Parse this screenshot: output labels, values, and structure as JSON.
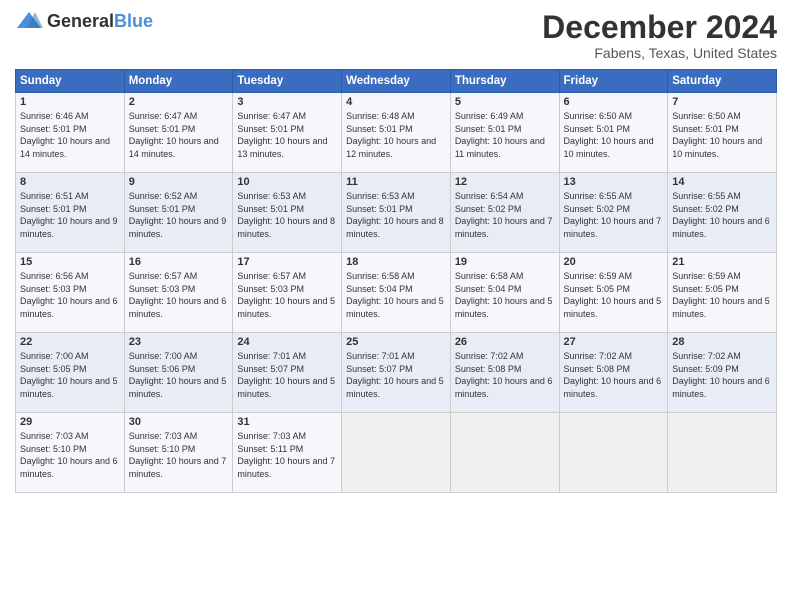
{
  "header": {
    "logo_general": "General",
    "logo_blue": "Blue",
    "month_title": "December 2024",
    "location": "Fabens, Texas, United States"
  },
  "weekdays": [
    "Sunday",
    "Monday",
    "Tuesday",
    "Wednesday",
    "Thursday",
    "Friday",
    "Saturday"
  ],
  "weeks": [
    [
      {
        "day": "1",
        "sunrise": "Sunrise: 6:46 AM",
        "sunset": "Sunset: 5:01 PM",
        "daylight": "Daylight: 10 hours and 14 minutes."
      },
      {
        "day": "2",
        "sunrise": "Sunrise: 6:47 AM",
        "sunset": "Sunset: 5:01 PM",
        "daylight": "Daylight: 10 hours and 14 minutes."
      },
      {
        "day": "3",
        "sunrise": "Sunrise: 6:47 AM",
        "sunset": "Sunset: 5:01 PM",
        "daylight": "Daylight: 10 hours and 13 minutes."
      },
      {
        "day": "4",
        "sunrise": "Sunrise: 6:48 AM",
        "sunset": "Sunset: 5:01 PM",
        "daylight": "Daylight: 10 hours and 12 minutes."
      },
      {
        "day": "5",
        "sunrise": "Sunrise: 6:49 AM",
        "sunset": "Sunset: 5:01 PM",
        "daylight": "Daylight: 10 hours and 11 minutes."
      },
      {
        "day": "6",
        "sunrise": "Sunrise: 6:50 AM",
        "sunset": "Sunset: 5:01 PM",
        "daylight": "Daylight: 10 hours and 10 minutes."
      },
      {
        "day": "7",
        "sunrise": "Sunrise: 6:50 AM",
        "sunset": "Sunset: 5:01 PM",
        "daylight": "Daylight: 10 hours and 10 minutes."
      }
    ],
    [
      {
        "day": "8",
        "sunrise": "Sunrise: 6:51 AM",
        "sunset": "Sunset: 5:01 PM",
        "daylight": "Daylight: 10 hours and 9 minutes."
      },
      {
        "day": "9",
        "sunrise": "Sunrise: 6:52 AM",
        "sunset": "Sunset: 5:01 PM",
        "daylight": "Daylight: 10 hours and 9 minutes."
      },
      {
        "day": "10",
        "sunrise": "Sunrise: 6:53 AM",
        "sunset": "Sunset: 5:01 PM",
        "daylight": "Daylight: 10 hours and 8 minutes."
      },
      {
        "day": "11",
        "sunrise": "Sunrise: 6:53 AM",
        "sunset": "Sunset: 5:01 PM",
        "daylight": "Daylight: 10 hours and 8 minutes."
      },
      {
        "day": "12",
        "sunrise": "Sunrise: 6:54 AM",
        "sunset": "Sunset: 5:02 PM",
        "daylight": "Daylight: 10 hours and 7 minutes."
      },
      {
        "day": "13",
        "sunrise": "Sunrise: 6:55 AM",
        "sunset": "Sunset: 5:02 PM",
        "daylight": "Daylight: 10 hours and 7 minutes."
      },
      {
        "day": "14",
        "sunrise": "Sunrise: 6:55 AM",
        "sunset": "Sunset: 5:02 PM",
        "daylight": "Daylight: 10 hours and 6 minutes."
      }
    ],
    [
      {
        "day": "15",
        "sunrise": "Sunrise: 6:56 AM",
        "sunset": "Sunset: 5:03 PM",
        "daylight": "Daylight: 10 hours and 6 minutes."
      },
      {
        "day": "16",
        "sunrise": "Sunrise: 6:57 AM",
        "sunset": "Sunset: 5:03 PM",
        "daylight": "Daylight: 10 hours and 6 minutes."
      },
      {
        "day": "17",
        "sunrise": "Sunrise: 6:57 AM",
        "sunset": "Sunset: 5:03 PM",
        "daylight": "Daylight: 10 hours and 5 minutes."
      },
      {
        "day": "18",
        "sunrise": "Sunrise: 6:58 AM",
        "sunset": "Sunset: 5:04 PM",
        "daylight": "Daylight: 10 hours and 5 minutes."
      },
      {
        "day": "19",
        "sunrise": "Sunrise: 6:58 AM",
        "sunset": "Sunset: 5:04 PM",
        "daylight": "Daylight: 10 hours and 5 minutes."
      },
      {
        "day": "20",
        "sunrise": "Sunrise: 6:59 AM",
        "sunset": "Sunset: 5:05 PM",
        "daylight": "Daylight: 10 hours and 5 minutes."
      },
      {
        "day": "21",
        "sunrise": "Sunrise: 6:59 AM",
        "sunset": "Sunset: 5:05 PM",
        "daylight": "Daylight: 10 hours and 5 minutes."
      }
    ],
    [
      {
        "day": "22",
        "sunrise": "Sunrise: 7:00 AM",
        "sunset": "Sunset: 5:05 PM",
        "daylight": "Daylight: 10 hours and 5 minutes."
      },
      {
        "day": "23",
        "sunrise": "Sunrise: 7:00 AM",
        "sunset": "Sunset: 5:06 PM",
        "daylight": "Daylight: 10 hours and 5 minutes."
      },
      {
        "day": "24",
        "sunrise": "Sunrise: 7:01 AM",
        "sunset": "Sunset: 5:07 PM",
        "daylight": "Daylight: 10 hours and 5 minutes."
      },
      {
        "day": "25",
        "sunrise": "Sunrise: 7:01 AM",
        "sunset": "Sunset: 5:07 PM",
        "daylight": "Daylight: 10 hours and 5 minutes."
      },
      {
        "day": "26",
        "sunrise": "Sunrise: 7:02 AM",
        "sunset": "Sunset: 5:08 PM",
        "daylight": "Daylight: 10 hours and 6 minutes."
      },
      {
        "day": "27",
        "sunrise": "Sunrise: 7:02 AM",
        "sunset": "Sunset: 5:08 PM",
        "daylight": "Daylight: 10 hours and 6 minutes."
      },
      {
        "day": "28",
        "sunrise": "Sunrise: 7:02 AM",
        "sunset": "Sunset: 5:09 PM",
        "daylight": "Daylight: 10 hours and 6 minutes."
      }
    ],
    [
      {
        "day": "29",
        "sunrise": "Sunrise: 7:03 AM",
        "sunset": "Sunset: 5:10 PM",
        "daylight": "Daylight: 10 hours and 6 minutes."
      },
      {
        "day": "30",
        "sunrise": "Sunrise: 7:03 AM",
        "sunset": "Sunset: 5:10 PM",
        "daylight": "Daylight: 10 hours and 7 minutes."
      },
      {
        "day": "31",
        "sunrise": "Sunrise: 7:03 AM",
        "sunset": "Sunset: 5:11 PM",
        "daylight": "Daylight: 10 hours and 7 minutes."
      },
      null,
      null,
      null,
      null
    ]
  ]
}
